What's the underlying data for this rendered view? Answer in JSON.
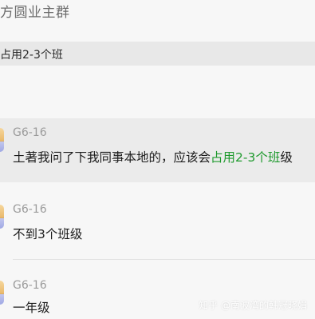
{
  "chat": {
    "title": "方圆业主群",
    "search_query": "占用2-3个班"
  },
  "messages": [
    {
      "sender": "G6-16",
      "text_before": "土著我问了下我同事本地的，应该会",
      "text_highlight": "占用2-3个班",
      "text_after": "级"
    },
    {
      "sender": "G6-16",
      "text": "不到3个班级"
    },
    {
      "sender": "G6-16",
      "text": "一年级"
    }
  ],
  "watermark": "知乎 @南波湾的韩冠晓娟",
  "colors": {
    "highlight_text": "#1f9a2e",
    "selected_row_bg": "#ebebeb",
    "search_bar_bg": "#e8e8e8"
  }
}
